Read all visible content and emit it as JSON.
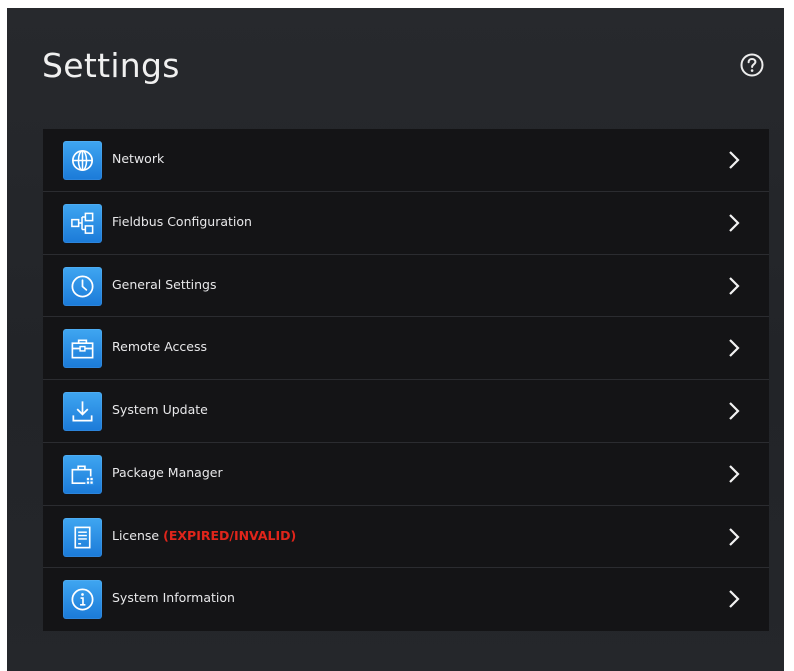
{
  "header": {
    "title": "Settings",
    "help_icon": "help-circle-icon"
  },
  "items": [
    {
      "label": "Network",
      "icon": "globe-icon"
    },
    {
      "label": "Fieldbus Configuration",
      "icon": "fieldbus-icon"
    },
    {
      "label": "General Settings",
      "icon": "clock-icon"
    },
    {
      "label": "Remote Access",
      "icon": "toolbox-icon"
    },
    {
      "label": "System Update",
      "icon": "download-icon"
    },
    {
      "label": "Package Manager",
      "icon": "package-icon"
    },
    {
      "label": "License",
      "status": "(EXPIRED/INVALID)",
      "icon": "license-icon"
    },
    {
      "label": "System Information",
      "icon": "info-icon"
    }
  ],
  "colors": {
    "accent": "#2b8ee6",
    "warning": "#e0251b",
    "background": "#242629",
    "list_background": "#141416"
  }
}
